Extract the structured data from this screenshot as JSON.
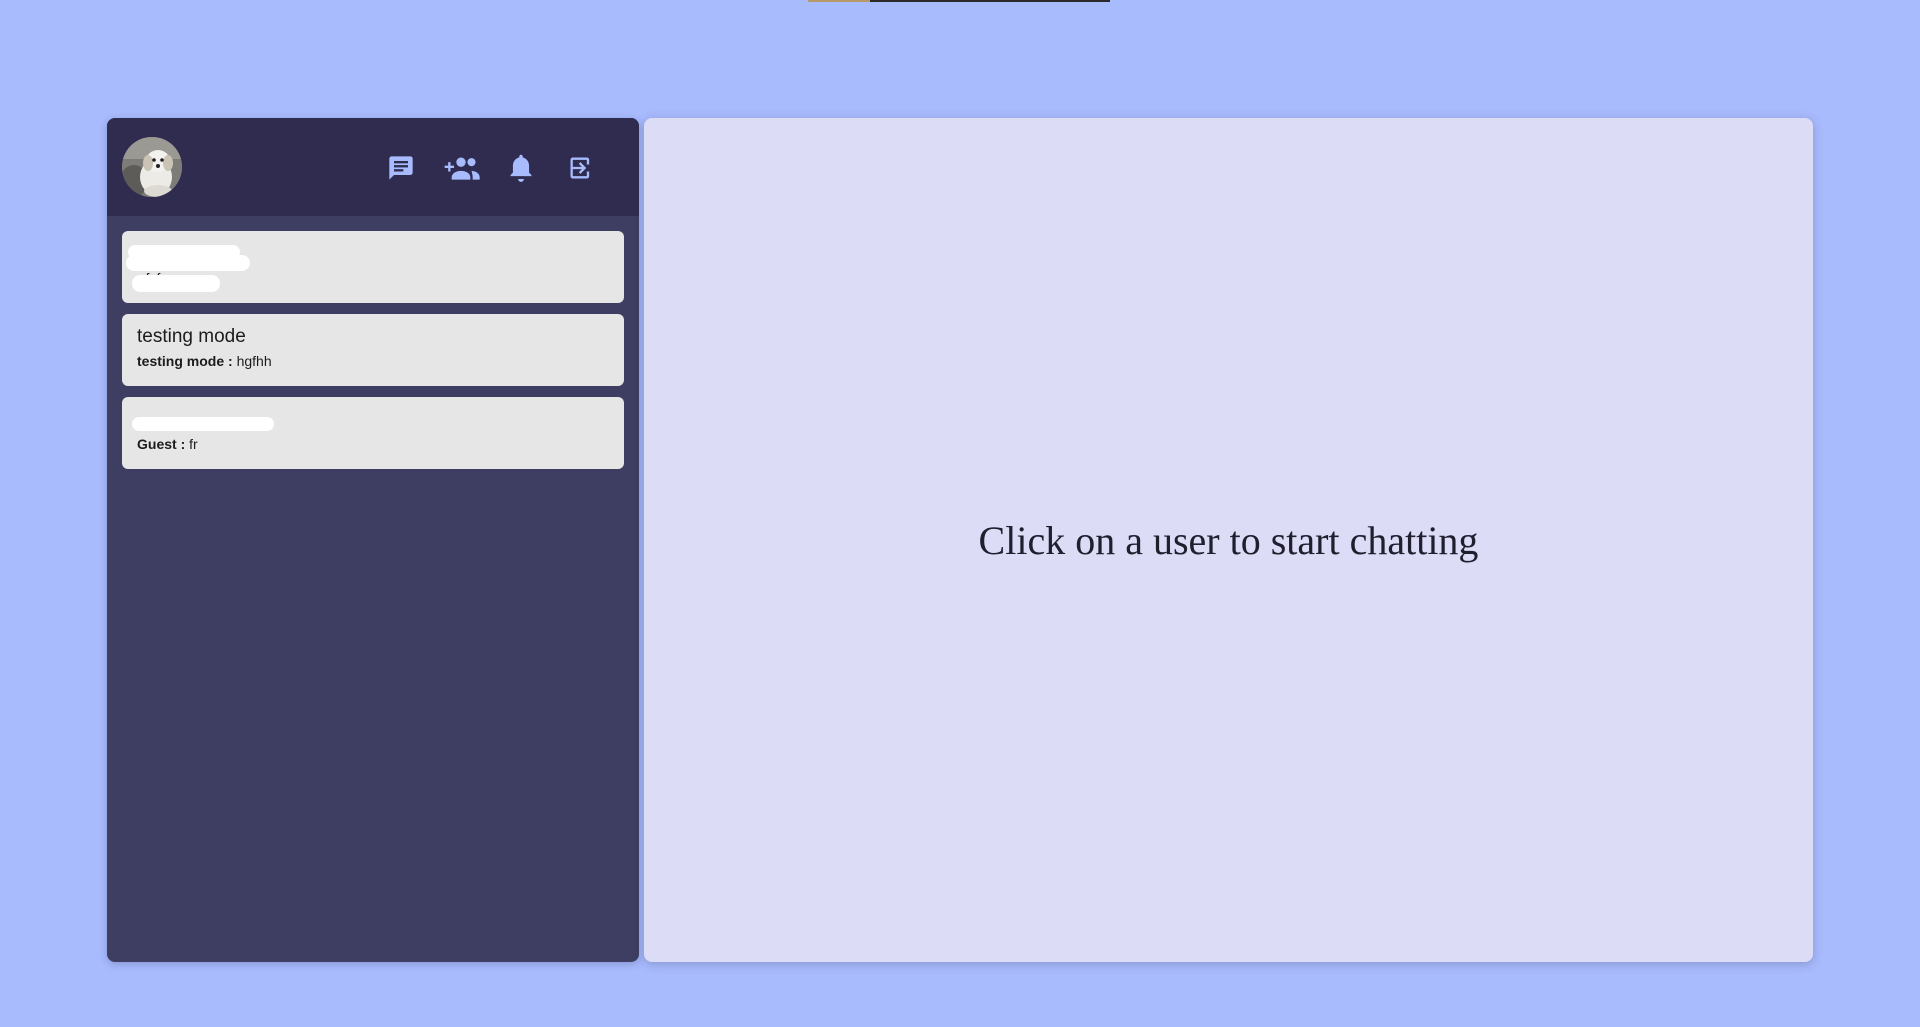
{
  "header": {
    "avatar_alt": "profile-avatar",
    "icons": [
      {
        "name": "chat-icon"
      },
      {
        "name": "add-group-icon"
      },
      {
        "name": "bell-icon"
      },
      {
        "name": "logout-icon"
      }
    ]
  },
  "chats": [
    {
      "name": "",
      "sender": "",
      "message": "fcf",
      "name_redacted": true
    },
    {
      "name": "testing mode",
      "sender": "testing mode",
      "message": "hgfhh",
      "name_redacted": false
    },
    {
      "name": "",
      "sender": "Guest",
      "message": "fr",
      "name_redacted": true
    }
  ],
  "main": {
    "placeholder": "Click on a user to start chatting"
  },
  "colors": {
    "page_bg": "#a8bbfd",
    "sidebar_bg": "#3e3e62",
    "header_bg": "#2f2c50",
    "icon_color": "#a8bbfd",
    "chat_item_bg": "#e6e6e6",
    "main_bg": "#dddcf7"
  }
}
